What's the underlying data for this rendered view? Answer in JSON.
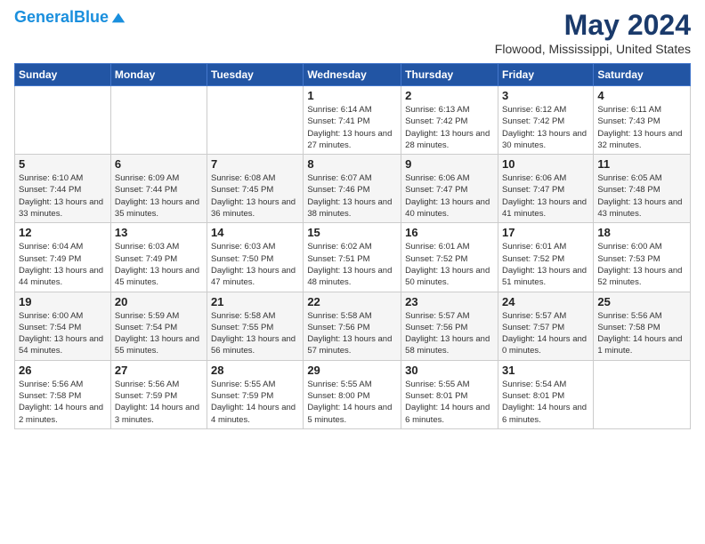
{
  "header": {
    "logo_line1": "General",
    "logo_line2": "Blue",
    "month_title": "May 2024",
    "location": "Flowood, Mississippi, United States"
  },
  "days_of_week": [
    "Sunday",
    "Monday",
    "Tuesday",
    "Wednesday",
    "Thursday",
    "Friday",
    "Saturday"
  ],
  "weeks": [
    [
      {
        "day": "",
        "info": ""
      },
      {
        "day": "",
        "info": ""
      },
      {
        "day": "",
        "info": ""
      },
      {
        "day": "1",
        "info": "Sunrise: 6:14 AM\nSunset: 7:41 PM\nDaylight: 13 hours and 27 minutes."
      },
      {
        "day": "2",
        "info": "Sunrise: 6:13 AM\nSunset: 7:42 PM\nDaylight: 13 hours and 28 minutes."
      },
      {
        "day": "3",
        "info": "Sunrise: 6:12 AM\nSunset: 7:42 PM\nDaylight: 13 hours and 30 minutes."
      },
      {
        "day": "4",
        "info": "Sunrise: 6:11 AM\nSunset: 7:43 PM\nDaylight: 13 hours and 32 minutes."
      }
    ],
    [
      {
        "day": "5",
        "info": "Sunrise: 6:10 AM\nSunset: 7:44 PM\nDaylight: 13 hours and 33 minutes."
      },
      {
        "day": "6",
        "info": "Sunrise: 6:09 AM\nSunset: 7:44 PM\nDaylight: 13 hours and 35 minutes."
      },
      {
        "day": "7",
        "info": "Sunrise: 6:08 AM\nSunset: 7:45 PM\nDaylight: 13 hours and 36 minutes."
      },
      {
        "day": "8",
        "info": "Sunrise: 6:07 AM\nSunset: 7:46 PM\nDaylight: 13 hours and 38 minutes."
      },
      {
        "day": "9",
        "info": "Sunrise: 6:06 AM\nSunset: 7:47 PM\nDaylight: 13 hours and 40 minutes."
      },
      {
        "day": "10",
        "info": "Sunrise: 6:06 AM\nSunset: 7:47 PM\nDaylight: 13 hours and 41 minutes."
      },
      {
        "day": "11",
        "info": "Sunrise: 6:05 AM\nSunset: 7:48 PM\nDaylight: 13 hours and 43 minutes."
      }
    ],
    [
      {
        "day": "12",
        "info": "Sunrise: 6:04 AM\nSunset: 7:49 PM\nDaylight: 13 hours and 44 minutes."
      },
      {
        "day": "13",
        "info": "Sunrise: 6:03 AM\nSunset: 7:49 PM\nDaylight: 13 hours and 45 minutes."
      },
      {
        "day": "14",
        "info": "Sunrise: 6:03 AM\nSunset: 7:50 PM\nDaylight: 13 hours and 47 minutes."
      },
      {
        "day": "15",
        "info": "Sunrise: 6:02 AM\nSunset: 7:51 PM\nDaylight: 13 hours and 48 minutes."
      },
      {
        "day": "16",
        "info": "Sunrise: 6:01 AM\nSunset: 7:52 PM\nDaylight: 13 hours and 50 minutes."
      },
      {
        "day": "17",
        "info": "Sunrise: 6:01 AM\nSunset: 7:52 PM\nDaylight: 13 hours and 51 minutes."
      },
      {
        "day": "18",
        "info": "Sunrise: 6:00 AM\nSunset: 7:53 PM\nDaylight: 13 hours and 52 minutes."
      }
    ],
    [
      {
        "day": "19",
        "info": "Sunrise: 6:00 AM\nSunset: 7:54 PM\nDaylight: 13 hours and 54 minutes."
      },
      {
        "day": "20",
        "info": "Sunrise: 5:59 AM\nSunset: 7:54 PM\nDaylight: 13 hours and 55 minutes."
      },
      {
        "day": "21",
        "info": "Sunrise: 5:58 AM\nSunset: 7:55 PM\nDaylight: 13 hours and 56 minutes."
      },
      {
        "day": "22",
        "info": "Sunrise: 5:58 AM\nSunset: 7:56 PM\nDaylight: 13 hours and 57 minutes."
      },
      {
        "day": "23",
        "info": "Sunrise: 5:57 AM\nSunset: 7:56 PM\nDaylight: 13 hours and 58 minutes."
      },
      {
        "day": "24",
        "info": "Sunrise: 5:57 AM\nSunset: 7:57 PM\nDaylight: 14 hours and 0 minutes."
      },
      {
        "day": "25",
        "info": "Sunrise: 5:56 AM\nSunset: 7:58 PM\nDaylight: 14 hours and 1 minute."
      }
    ],
    [
      {
        "day": "26",
        "info": "Sunrise: 5:56 AM\nSunset: 7:58 PM\nDaylight: 14 hours and 2 minutes."
      },
      {
        "day": "27",
        "info": "Sunrise: 5:56 AM\nSunset: 7:59 PM\nDaylight: 14 hours and 3 minutes."
      },
      {
        "day": "28",
        "info": "Sunrise: 5:55 AM\nSunset: 7:59 PM\nDaylight: 14 hours and 4 minutes."
      },
      {
        "day": "29",
        "info": "Sunrise: 5:55 AM\nSunset: 8:00 PM\nDaylight: 14 hours and 5 minutes."
      },
      {
        "day": "30",
        "info": "Sunrise: 5:55 AM\nSunset: 8:01 PM\nDaylight: 14 hours and 6 minutes."
      },
      {
        "day": "31",
        "info": "Sunrise: 5:54 AM\nSunset: 8:01 PM\nDaylight: 14 hours and 6 minutes."
      },
      {
        "day": "",
        "info": ""
      }
    ]
  ]
}
